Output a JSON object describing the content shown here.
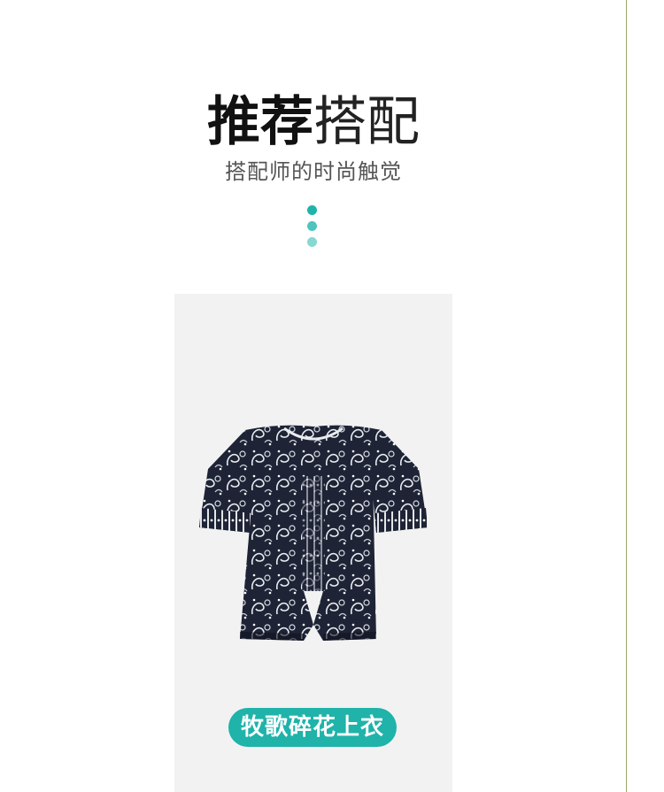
{
  "header": {
    "title_bold": "推荐",
    "title_light": "搭配",
    "subtitle": "搭配师的时尚触觉"
  },
  "dots": [
    {
      "color": "#1fb3aa"
    },
    {
      "color": "#4dc4bd"
    },
    {
      "color": "#86d8d3"
    }
  ],
  "product": {
    "name": "牧歌碎花上衣",
    "image_icon": "patterned-blouse-icon",
    "pill_color": "#1fb3aa"
  },
  "colors": {
    "card_bg": "#f2f2f2",
    "accent": "#1fb3aa"
  }
}
